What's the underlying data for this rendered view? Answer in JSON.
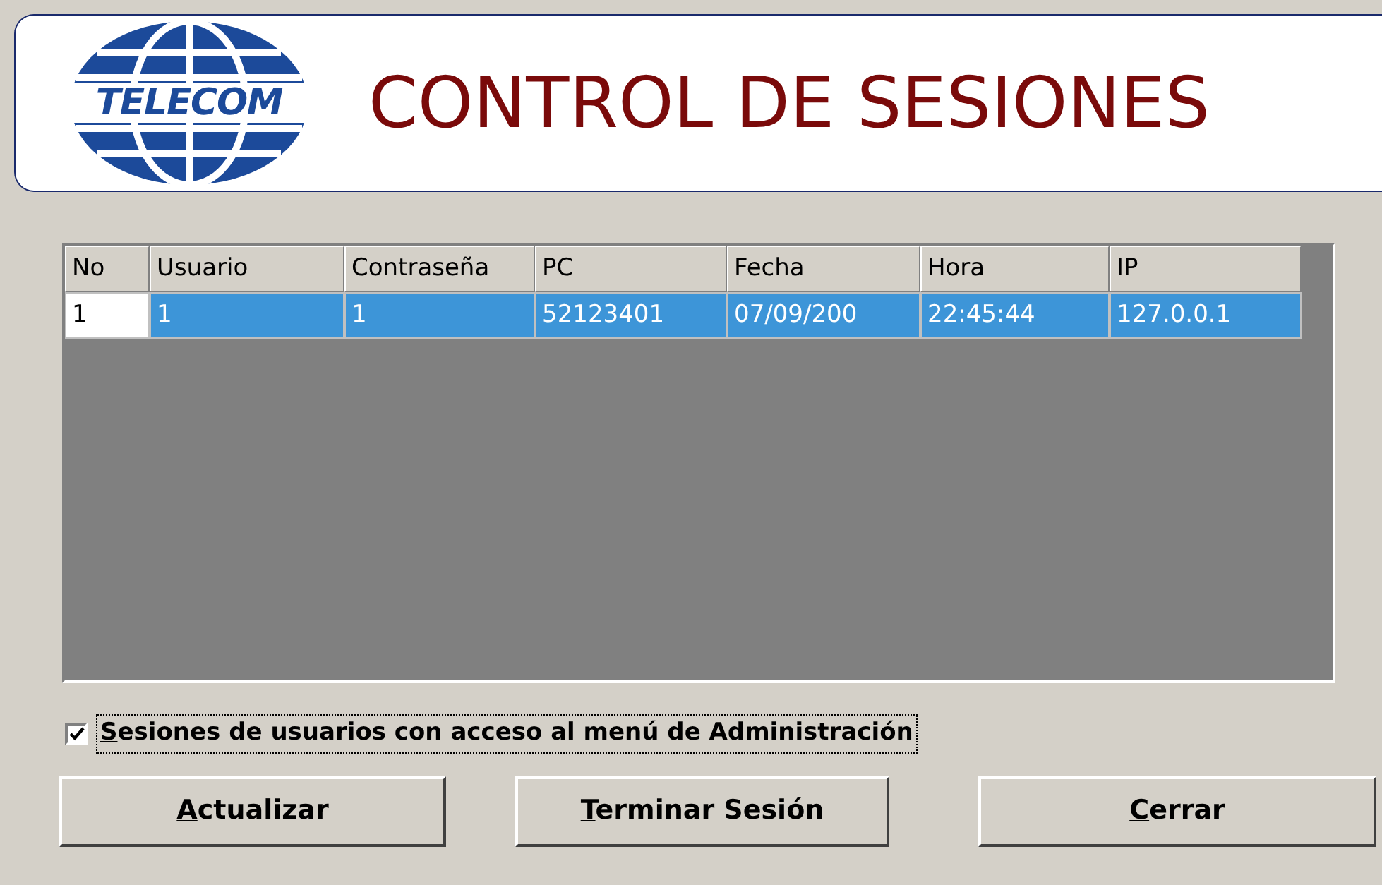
{
  "header": {
    "logo_text": "TELECOM",
    "title": "CONTROL DE SESIONES"
  },
  "table": {
    "columns": [
      "No",
      "Usuario",
      "Contraseña",
      "PC",
      "Fecha",
      "Hora",
      "IP"
    ],
    "rows": [
      {
        "selected": true,
        "cells": [
          "1",
          "1",
          "1",
          "52123401",
          "07/09/200",
          "22:45:44",
          "127.0.0.1"
        ]
      }
    ]
  },
  "checkbox": {
    "mnemonic": "S",
    "rest": "esiones de usuarios con acceso al menú de Administración",
    "checked": true
  },
  "buttons": [
    {
      "mnemonic": "A",
      "rest": "ctualizar"
    },
    {
      "mnemonic": "T",
      "rest": "erminar Sesión"
    },
    {
      "mnemonic": "C",
      "rest": "errar"
    }
  ]
}
